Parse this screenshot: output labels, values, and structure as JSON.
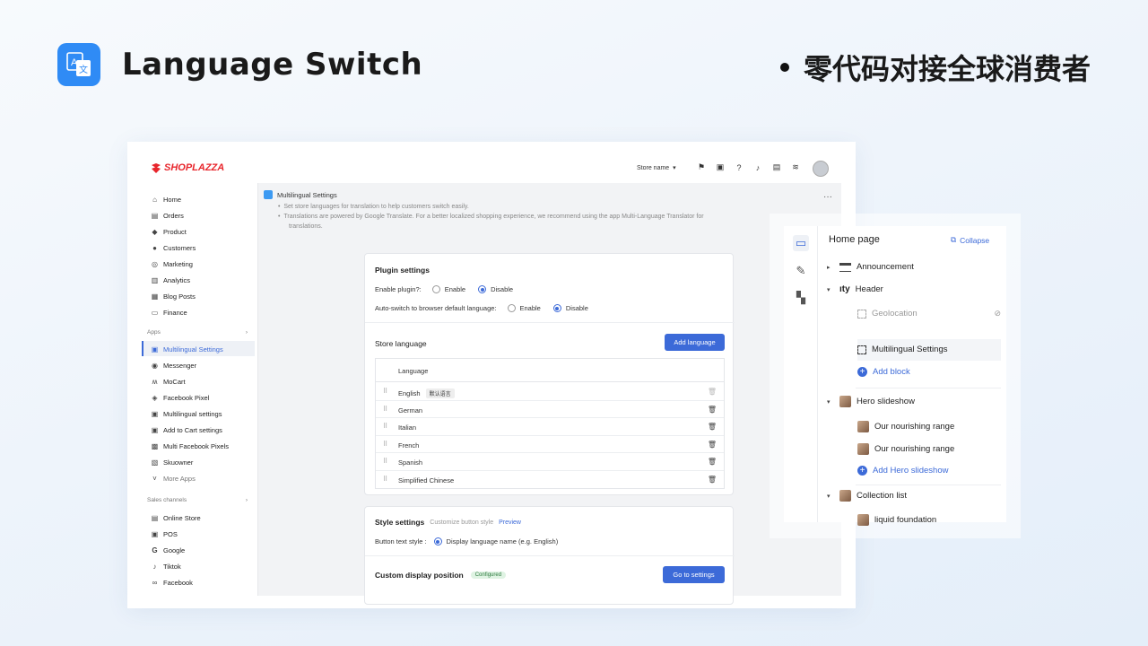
{
  "hero": {
    "title": "Language Switch",
    "tagline": "零代码对接全球消费者",
    "icon": "translate-icon",
    "icon_color": "#2f8bf5"
  },
  "topbar": {
    "logo": "SHOPLAZZA",
    "store_name": "Store name",
    "icons": [
      "flag-icon",
      "store-icon",
      "help-icon",
      "bell-icon",
      "chat-icon",
      "wifi-icon"
    ],
    "logo_color": "#e8262c"
  },
  "sidebar": {
    "main_items": [
      "Home",
      "Orders",
      "Product",
      "Customers",
      "Marketing",
      "Analytics",
      "Blog Posts",
      "Finance"
    ],
    "apps_label": "Apps",
    "apps_items": [
      "Multilingual Settings",
      "Messenger",
      "MoCart",
      "Facebook Pixel",
      "Multilingual settings",
      "Add to Cart settings",
      "Multi Facebook Pixels",
      "Skuowner",
      "More Apps"
    ],
    "channels_label": "Sales channels",
    "channels_items": [
      "Online Store",
      "POS",
      "Google",
      "Tiktok",
      "Facebook"
    ]
  },
  "page": {
    "title": "Multilingual Settings",
    "note1": "Set store languages for translation to help customers switch easily.",
    "note2": "Translations are powered by Google Translate. For a better localized shopping experience, we recommend using the app Multi-Language Translator for",
    "note3": "translations."
  },
  "plugin": {
    "title": "Plugin settings",
    "enable_label": "Enable plugin?:",
    "auto_label": "Auto-switch to browser default language:",
    "opt_enable": "Enable",
    "opt_disable": "Disable"
  },
  "store_language": {
    "title": "Store language",
    "add_button": "Add language",
    "column": "Language",
    "default_badge": "默认语言",
    "languages": [
      "English",
      "German",
      "Italian",
      "French",
      "Spanish",
      "Simplified Chinese"
    ]
  },
  "style": {
    "title": "Style settings",
    "customize": "Customize button style",
    "preview": "Preview",
    "text_style_label": "Button text style :",
    "text_style_value": "Display language name (e.g. English)",
    "custom_position": "Custom display position",
    "configured": "Configured",
    "go_button": "Go to settings"
  },
  "panel": {
    "title": "Home page",
    "collapse": "Collapse",
    "announcement": "Announcement",
    "header": "Header",
    "geolocation": "Geolocation",
    "multilingual": "Multilingual Settings",
    "add_block": "Add block",
    "hero_slideshow": "Hero slideshow",
    "slide1": "Our nourishing range",
    "slide2": "Our nourishing range",
    "add_hero": "Add Hero slideshow",
    "collection_list": "Collection list",
    "collection_item": "liquid foundation"
  },
  "accent_color": "#3c6ad8"
}
